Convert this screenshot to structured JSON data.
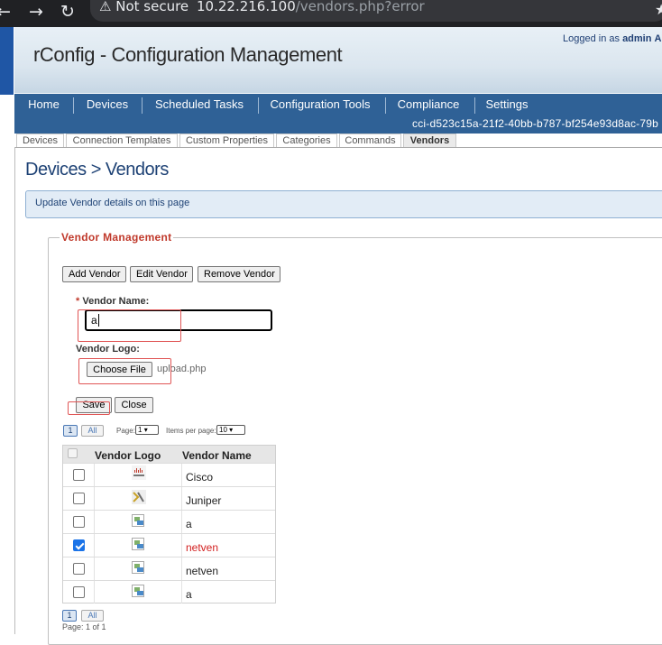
{
  "browser": {
    "security_label": "Not secure",
    "url_host": "10.22.216.100",
    "url_path": "/vendors.php?error"
  },
  "header": {
    "app_title": "rConfig - Configuration Management",
    "logged_in_prefix": "Logged in as",
    "logged_in_user": "admin",
    "logged_in_suffix": "A"
  },
  "main_nav": {
    "items": [
      "Home",
      "Devices",
      "Scheduled Tasks",
      "Configuration Tools",
      "Compliance",
      "Settings"
    ],
    "instance_id": "cci-d523c15a-21f2-40bb-b787-bf254e93d8ac-79b"
  },
  "sub_tabs": {
    "items": [
      "Devices",
      "Connection Templates",
      "Custom Properties",
      "Categories",
      "Commands",
      "Vendors"
    ],
    "active": "Vendors"
  },
  "page": {
    "heading": "Devices > Vendors",
    "info_text": "Update Vendor details on this page"
  },
  "vendor_management": {
    "legend": "Vendor Management",
    "buttons": {
      "add": "Add Vendor",
      "edit": "Edit Vendor",
      "remove": "Remove Vendor"
    },
    "form": {
      "required_marker": "*",
      "name_label": "Vendor Name:",
      "name_value": "a",
      "logo_label": "Vendor Logo:",
      "choose_file_label": "Choose File",
      "chosen_file": "upload.php",
      "save_label": "Save",
      "close_label": "Close"
    },
    "pager": {
      "page_button": "1",
      "all_button": "All",
      "page_label": "Page:",
      "page_value": "1",
      "items_label": "Items per page:",
      "items_value": "10",
      "footer_prefix": "Page:",
      "footer_value": "1 of 1"
    },
    "table": {
      "columns": [
        "Vendor Logo",
        "Vendor Name"
      ],
      "rows": [
        {
          "logo": "cisco-logo",
          "name": "Cisco",
          "checked": false
        },
        {
          "logo": "juniper-logo",
          "name": "Juniper",
          "checked": false
        },
        {
          "logo": "broken-image",
          "name": "a",
          "checked": false
        },
        {
          "logo": "broken-image",
          "name": "netven",
          "checked": true
        },
        {
          "logo": "broken-image",
          "name": "netven",
          "checked": false
        },
        {
          "logo": "broken-image",
          "name": "a",
          "checked": false
        }
      ]
    }
  },
  "colors": {
    "nav_bg": "#2f6196",
    "heading": "#1e4275",
    "legend": "#c0392b",
    "highlight_box": "#e05555",
    "selected_row_text": "#d21f1f"
  }
}
